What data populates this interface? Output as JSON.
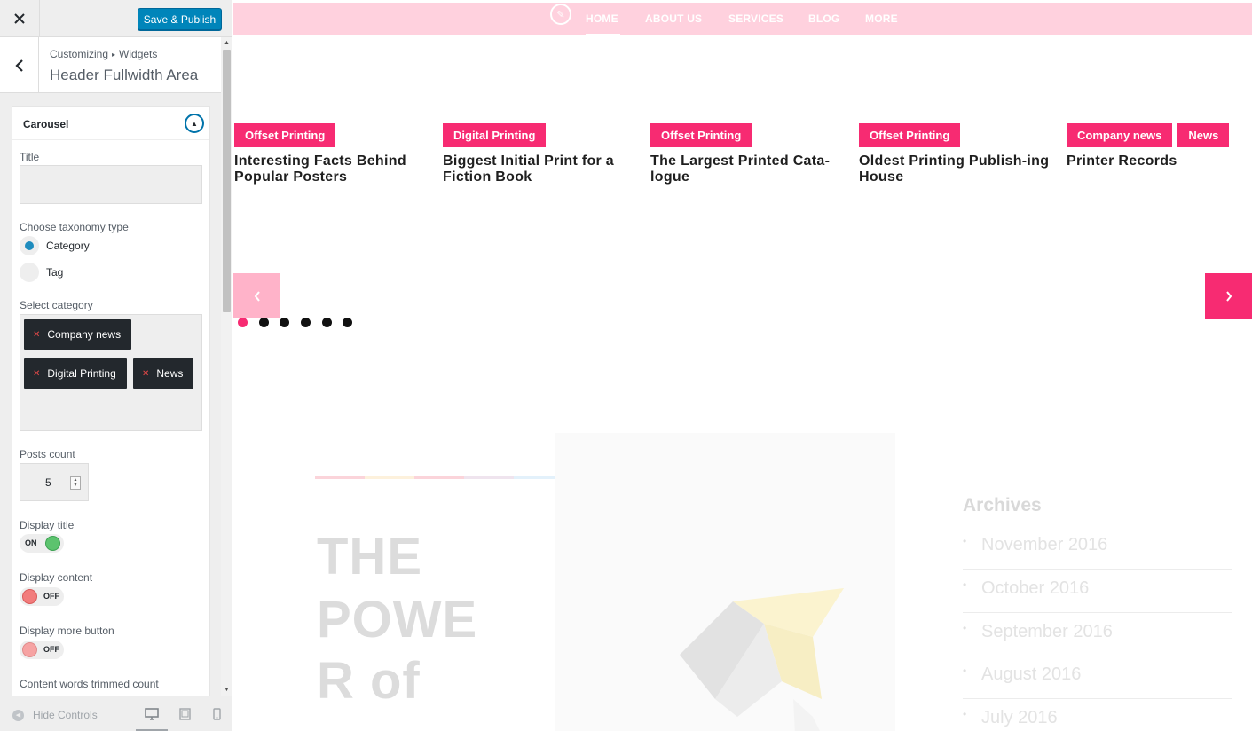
{
  "customizer": {
    "close_icon": "close-icon",
    "save_label": "Save & Publish",
    "breadcrumb": [
      "Customizing",
      "Widgets"
    ],
    "section_title": "Header Fullwidth Area",
    "widget": {
      "name": "Carousel",
      "title_label": "Title",
      "title_value": "",
      "taxonomy_label": "Choose taxonomy type",
      "taxonomy_options": [
        "Category",
        "Tag"
      ],
      "taxonomy_selected": "Category",
      "category_label": "Select category",
      "selected_categories": [
        "Company news",
        "Digital Printing",
        "News"
      ],
      "posts_count_label": "Posts count",
      "posts_count": "5",
      "display_title_label": "Display title",
      "display_title_state": "ON",
      "display_content_label": "Display content",
      "display_content_state": "OFF",
      "display_more_label": "Display more button",
      "display_more_state": "OFF",
      "trim_label": "Content words trimmed count"
    },
    "footer": {
      "hide_controls": "Hide Controls",
      "devices": [
        "desktop-icon",
        "tablet-icon",
        "mobile-icon"
      ]
    }
  },
  "preview": {
    "nav": [
      "HOME",
      "ABOUT US",
      "SERVICES",
      "BLOG",
      "MORE"
    ],
    "slides": [
      {
        "categories": [
          "Offset Printing"
        ],
        "title": "Interesting Facts Behind Popular Posters"
      },
      {
        "categories": [
          "Digital Printing"
        ],
        "title": "Biggest Initial Print for a Fiction Book"
      },
      {
        "categories": [
          "Offset Printing"
        ],
        "title": "The Largest Printed Cata-logue"
      },
      {
        "categories": [
          "Offset Printing"
        ],
        "title": "Oldest Printing Publish-ing House"
      },
      {
        "categories": [
          "Company news",
          "News"
        ],
        "title": "Printer Records"
      }
    ],
    "dots": 6,
    "active_dot": 0,
    "hero_lines": [
      "THE",
      "POWE",
      "R of"
    ],
    "archives": {
      "title": "Archives",
      "items": [
        "November 2016",
        "October 2016",
        "September 2016",
        "August 2016",
        "July 2016"
      ]
    },
    "colors": {
      "accent": "#f72b72",
      "nav_bg": "#ffd1de",
      "wp_blue": "#0085ba"
    }
  }
}
